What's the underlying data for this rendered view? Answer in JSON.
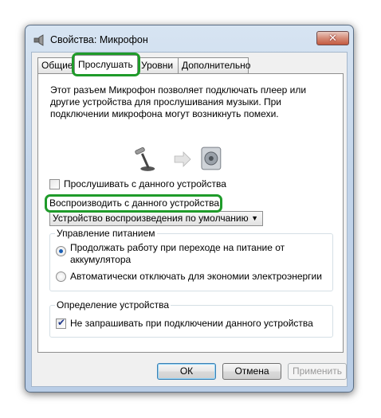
{
  "window": {
    "title": "Свойства: Микрофон",
    "close_glyph": "✕"
  },
  "tabs": [
    {
      "label": "Общие"
    },
    {
      "label": "Прослушать",
      "active": true
    },
    {
      "label": "Уровни"
    },
    {
      "label": "Дополнительно"
    }
  ],
  "listen": {
    "description": "Этот разъем Микрофон позволяет подключать плеер или другие устройства для прослушивания музыки. При подключении микрофона могут возникнуть помехи.",
    "listen_checkbox": {
      "label": "Прослушивать с данного устройства",
      "checked": false
    },
    "playback_label": "Воспроизводить с данного устройства:",
    "playback_device": "Устройство воспроизведения по умолчанию",
    "power": {
      "title": "Управление питанием",
      "options": [
        {
          "label": "Продолжать работу при переходе на питание от аккумулятора",
          "checked": true
        },
        {
          "label": "Автоматически отключать для экономии электроэнергии",
          "checked": false
        }
      ]
    },
    "detection": {
      "title": "Определение устройства",
      "checkbox": {
        "label": "Не запрашивать при подключении данного устройства",
        "checked": true
      }
    }
  },
  "buttons": {
    "ok": "ОК",
    "cancel": "Отмена",
    "apply": "Применить"
  },
  "colors": {
    "highlight": "#1f9b2a",
    "accent": "#1a5fb4"
  },
  "icons": [
    "microphone-icon",
    "arrow-right-icon",
    "speaker-icon",
    "window-icon"
  ]
}
